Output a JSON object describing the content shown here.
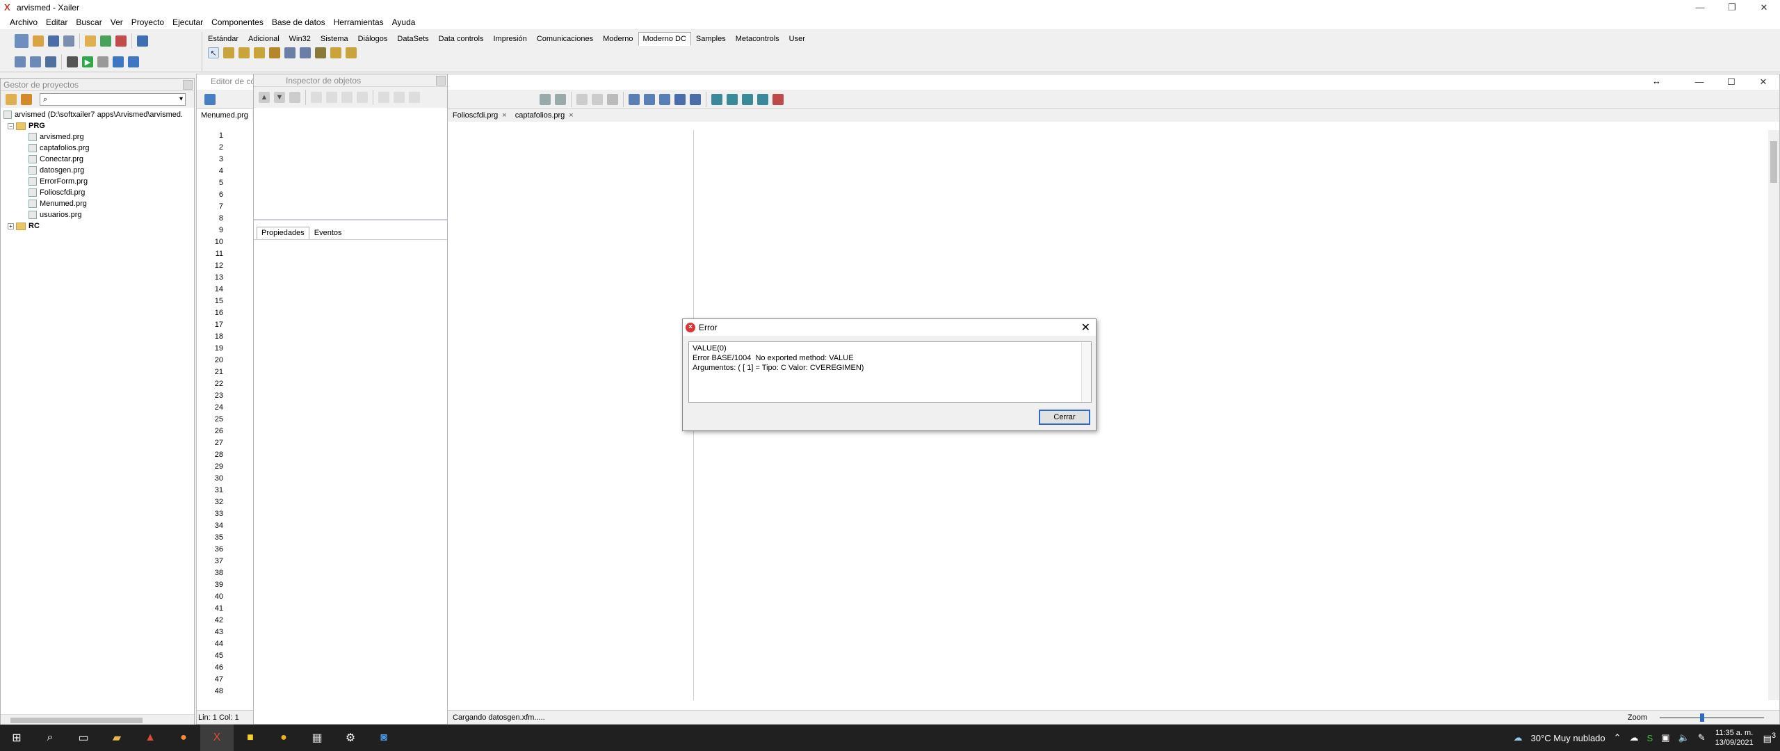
{
  "window": {
    "title": "arvismed - Xailer"
  },
  "menu": [
    "Archivo",
    "Editar",
    "Buscar",
    "Ver",
    "Proyecto",
    "Ejecutar",
    "Componentes",
    "Base de datos",
    "Herramientas",
    "Ayuda"
  ],
  "palette_tabs": [
    "Estándar",
    "Adicional",
    "Win32",
    "Sistema",
    "Diálogos",
    "DataSets",
    "Data controls",
    "Impresión",
    "Comunicaciones",
    "Moderno",
    "Moderno DC",
    "Samples",
    "Metacontrols",
    "User"
  ],
  "palette_active": "Moderno DC",
  "project_manager": {
    "title": "Gestor de proyectos",
    "root": "arvismed  (D:\\softxailer7 apps\\Arvismed\\arvismed.",
    "folder_prg": "PRG",
    "files": [
      "arvismed.prg",
      "captafolios.prg",
      "Conectar.prg",
      "datosgen.prg",
      "ErrorForm.prg",
      "Folioscfdi.prg",
      "Menumed.prg",
      "usuarios.prg"
    ],
    "folder_rc": "RC"
  },
  "editor": {
    "title": "Editor de có",
    "tabs": [
      "Menumed.prg",
      "Folioscfdi.prg",
      "captafolios.prg"
    ],
    "status_pos": "Lin: 1   Col: 1",
    "status_msg": "Cargando datosgen.xfm.....",
    "zoom_label": "Zoom"
  },
  "inspector": {
    "title": "Inspector de objetos",
    "tabs": [
      "Propiedades",
      "Eventos"
    ]
  },
  "dialog": {
    "title": "Error",
    "message": "VALUE(0)\nError BASE/1004  No exported method: VALUE\nArgumentos: ( [ 1] = Tipo: C Valor: CVEREGIMEN)",
    "button": "Cerrar"
  },
  "taskbar": {
    "weather": "30°C  Muy nublado",
    "time": "11:35 a. m.",
    "date": "13/09/2021",
    "notif_count": "3"
  },
  "colors": {
    "accent": "#2a6acb",
    "error": "#d93636",
    "taskbar": "#202020"
  }
}
